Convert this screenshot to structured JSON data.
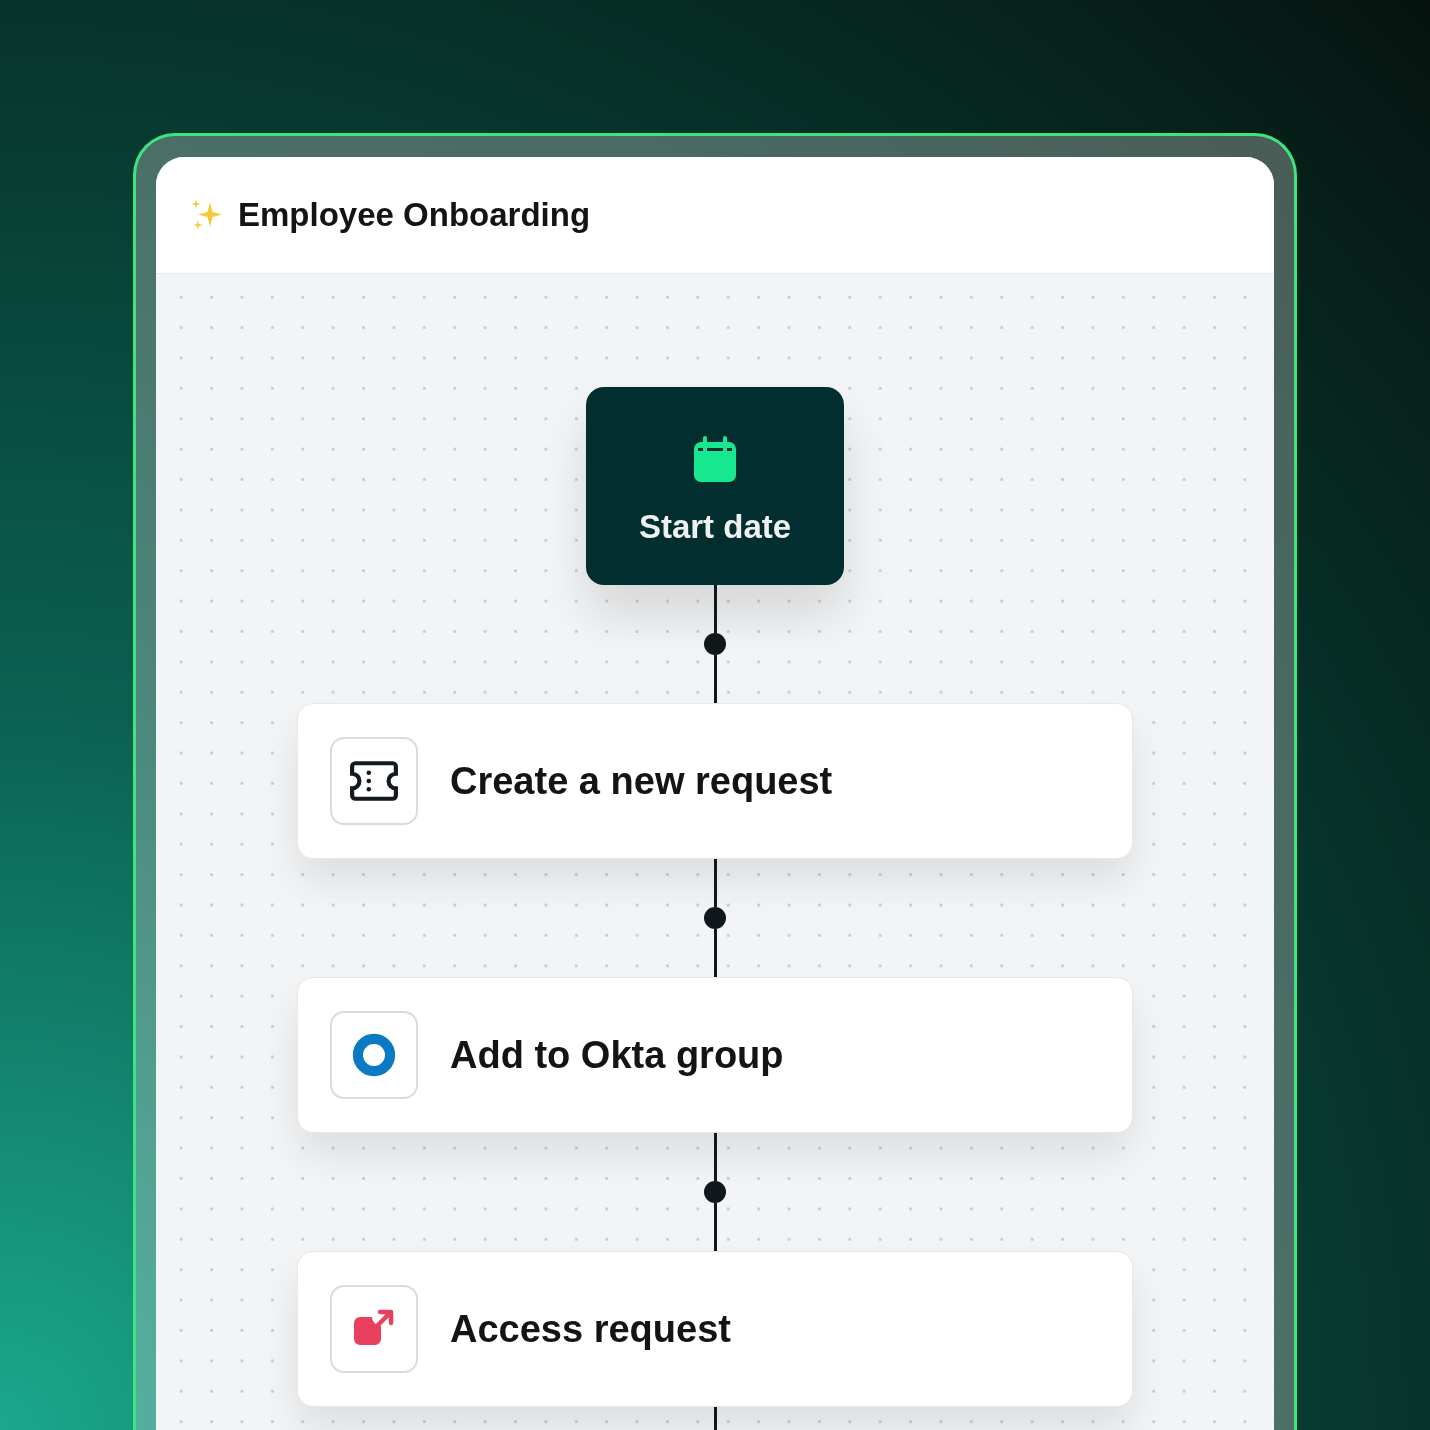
{
  "window": {
    "title": "Employee Onboarding"
  },
  "trigger": {
    "label": "Start date"
  },
  "steps": [
    {
      "label": "Create a new request",
      "kind": "ticket"
    },
    {
      "label": "Add to Okta group",
      "kind": "okta"
    },
    {
      "label": "Access request",
      "kind": "external"
    }
  ]
}
